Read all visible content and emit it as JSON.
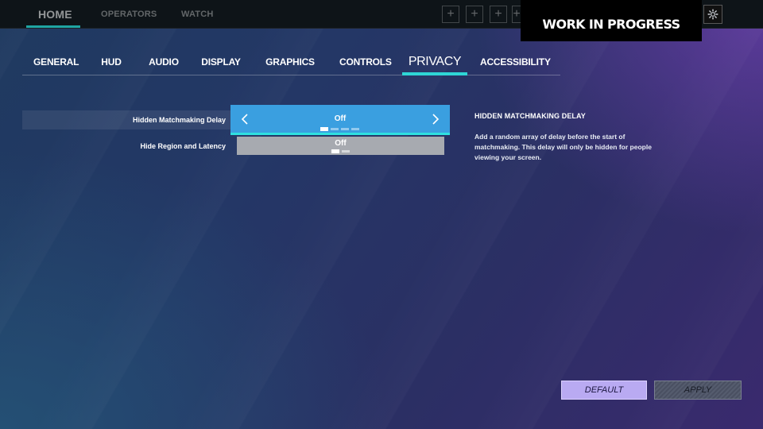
{
  "top_nav": {
    "items": [
      {
        "label": "HOME"
      },
      {
        "label": "OPERATORS"
      },
      {
        "label": "WATCH"
      }
    ],
    "slot_symbol": "+",
    "banner": "WORK IN PROGRESS",
    "gear_icon": "gear-icon"
  },
  "tabs": [
    {
      "label": "GENERAL"
    },
    {
      "label": "HUD"
    },
    {
      "label": "AUDIO"
    },
    {
      "label": "DISPLAY"
    },
    {
      "label": "GRAPHICS"
    },
    {
      "label": "CONTROLS"
    },
    {
      "label": "PRIVACY"
    },
    {
      "label": "ACCESSIBILITY"
    }
  ],
  "active_tab": "PRIVACY",
  "settings": [
    {
      "label": "Hidden Matchmaking Delay",
      "value": "Off",
      "options_count": 4,
      "selected_index": 0
    },
    {
      "label": "Hide Region and Latency",
      "value": "Off",
      "options_count": 2,
      "selected_index": 0
    }
  ],
  "description": {
    "title": "HIDDEN MATCHMAKING DELAY",
    "body": "Add a random array of delay before the start of matchmaking. This delay will only be hidden for people viewing your screen."
  },
  "buttons": {
    "default_label": "DEFAULT",
    "apply_label": "APPLY"
  },
  "colors": {
    "accent_teal": "#2fd6d6",
    "selector_blue": "#3a9fe0",
    "default_button": "#b9aaf2"
  }
}
